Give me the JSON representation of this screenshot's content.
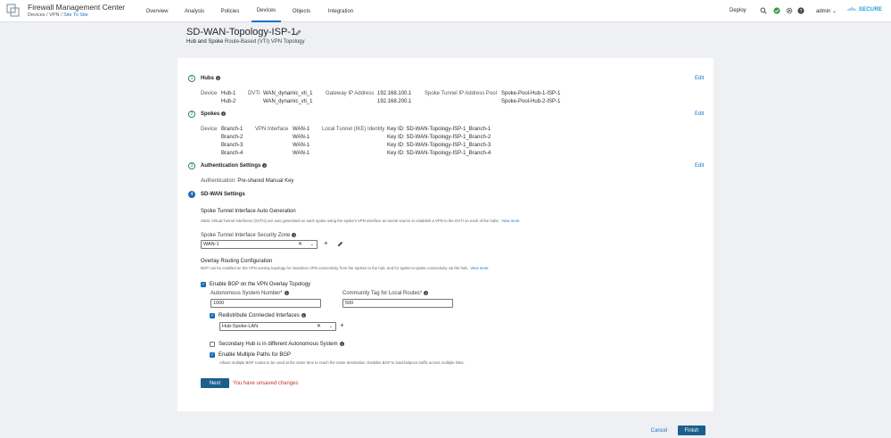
{
  "header": {
    "app_title": "Firewall Management Center",
    "crumb_1": "Devices",
    "crumb_sep": "/",
    "crumb_2": "VPN",
    "crumb_3": "Site To Site",
    "nav": [
      "Overview",
      "Analysis",
      "Policies",
      "Devices",
      "Objects",
      "Integration"
    ],
    "deploy": "Deploy",
    "user": "admin",
    "brand": "SECURE"
  },
  "page": {
    "title": "SD-WAN-Topology-ISP-1",
    "subtitle_bold": "Hub and Spoke",
    "subtitle_rest": " Route-Based (VTI) VPN Topology"
  },
  "hubs": {
    "step": "1",
    "title": "Hubs",
    "edit": "Edit",
    "device_label": "Device",
    "dvti_label": "DVTI",
    "gateway_label": "Gateway IP Address",
    "pool_label": "Spoke Tunnel IP Address Pool",
    "rows": [
      {
        "device": "Hub-1",
        "dvti": "WAN_dynamic_vti_1",
        "gateway": "192.168.100.1",
        "pool": "Spoke-Pool-Hub-1-ISP-1"
      },
      {
        "device": "Hub-2",
        "dvti": "WAN_dynamic_vti_1",
        "gateway": "192.168.200.1",
        "pool": "Spoke-Pool-Hub-2-ISP-1"
      }
    ]
  },
  "spokes": {
    "step": "2",
    "title": "Spokes",
    "edit": "Edit",
    "device_label": "Device",
    "vpn_label": "VPN Interface",
    "ike_label": "Local Tunnel (IKE) Identity",
    "rows": [
      {
        "device": "Branch-1",
        "vpn": "WAN-1",
        "ike": "Key ID: SD-WAN-Topology-ISP-1_Branch-1"
      },
      {
        "device": "Branch-2",
        "vpn": "WAN-1",
        "ike": "Key ID: SD-WAN-Topology-ISP-1_Branch-2"
      },
      {
        "device": "Branch-3",
        "vpn": "WAN-1",
        "ike": "Key ID: SD-WAN-Topology-ISP-1_Branch-3"
      },
      {
        "device": "Branch-4",
        "vpn": "WAN-1",
        "ike": "Key ID: SD-WAN-Topology-ISP-1_Branch-4"
      }
    ]
  },
  "auth": {
    "step": "3",
    "title": "Authentication Settings",
    "edit": "Edit",
    "label": "Authentication:",
    "value": "Pre-shared Manual Key"
  },
  "sdwan": {
    "step": "4",
    "title": "SD-WAN Settings",
    "auto_title": "Spoke Tunnel Interface Auto Generation",
    "auto_desc": "Static Virtual Tunnel Interfaces (SVTIs) are auto generated on each spoke using the spoke's VPN interface as tunnel source to establish a VPN to the DVTI on each of the hubs.",
    "view_more": "View more",
    "zone_label": "Spoke Tunnel Interface Security Zone",
    "zone_value": "WAN-1",
    "overlay_title": "Overlay Routing Configuration",
    "overlay_desc": "BGP can be enabled on the VPN overlay topology for seamless VPN connectivity from the spokes to the hub, and for spoke-to-spoke connectivity via the hub.",
    "enable_bgp": "Enable BGP on the VPN Overlay Topology",
    "asn_label": "Autonomous System Number",
    "asn_value": "1000",
    "community_label": "Community Tag for Local Routes",
    "community_value": "500",
    "required_mark": "*",
    "redistribute": "Redistribute Connected Interfaces",
    "redistribute_value": "Hub-Spoke-LAN",
    "secondary_hub": "Secondary Hub is in different Autonomous System",
    "multipath": "Enable Multiple Paths for BGP",
    "multipath_desc": "Allows multiple BGP routes to be used at the same time to reach the same destination. Enables BGP to load-balance traffic across multiple links."
  },
  "footer": {
    "next": "Next",
    "unsaved": "You have unsaved changes",
    "cancel": "Cancel",
    "finish": "Finish"
  }
}
